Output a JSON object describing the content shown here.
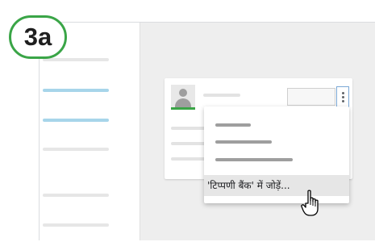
{
  "step_badge": "3a",
  "sidebar": {
    "highlighted_items": 2
  },
  "comment_menu": {
    "add_to_bank_label": "'टिप्पणी बैंक' में जोड़ें..."
  },
  "icons": {
    "avatar": "person-avatar-icon",
    "more_options": "more-vert-icon",
    "cursor": "hand-pointer-icon"
  },
  "colors": {
    "badge_ring": "#3aa547",
    "highlight": "#a7d5ea",
    "avatar_underline": "#3aa547",
    "focus_border": "#7aa8d6"
  }
}
